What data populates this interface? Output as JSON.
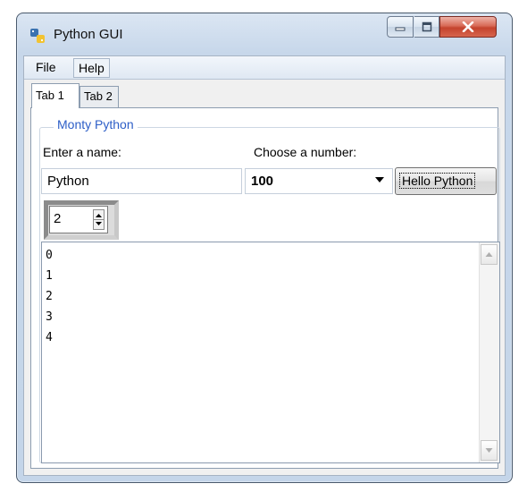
{
  "window": {
    "title": "Python GUI",
    "icon": "python-icon",
    "controls": [
      "minimize-icon",
      "maximize-icon",
      "close-icon"
    ]
  },
  "menu": {
    "items": [
      {
        "label": "File"
      },
      {
        "label": "Help"
      }
    ]
  },
  "tabs": [
    {
      "label": "Tab 1",
      "active": true
    },
    {
      "label": "Tab 2",
      "active": false
    }
  ],
  "group": {
    "title": "Monty Python",
    "name_label": "Enter a name:",
    "name_value": "Python",
    "number_label": "Choose a number:",
    "number_value": "100",
    "button_label": "Hello Python",
    "spin_value": "2"
  },
  "text_area": {
    "lines": [
      "0",
      "1",
      "2",
      "3",
      "4"
    ]
  },
  "colors": {
    "group_title": "#2d5ec7",
    "close_button": "#c4432d",
    "titlebar": "#c7d7ea"
  }
}
